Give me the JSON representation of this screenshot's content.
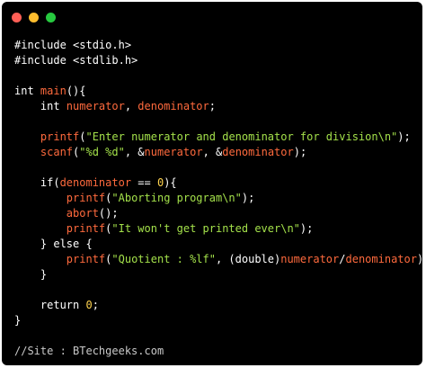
{
  "window": {
    "buttons": [
      {
        "name": "close-button",
        "color": "#ff5f56"
      },
      {
        "name": "minimize-button",
        "color": "#ffbd2e"
      },
      {
        "name": "maximize-button",
        "color": "#27c93f"
      }
    ]
  },
  "code": {
    "lines": [
      [
        {
          "t": "#include <stdio.h>",
          "c": "directive"
        }
      ],
      [
        {
          "t": "#include <stdlib.h>",
          "c": "directive"
        }
      ],
      [],
      [
        {
          "t": "int ",
          "c": "keyword"
        },
        {
          "t": "main",
          "c": "func"
        },
        {
          "t": "(){",
          "c": "plain"
        }
      ],
      [
        {
          "t": "    int ",
          "c": "keyword"
        },
        {
          "t": "numerator",
          "c": "var"
        },
        {
          "t": ", ",
          "c": "plain"
        },
        {
          "t": "denominator",
          "c": "var"
        },
        {
          "t": ";",
          "c": "plain"
        }
      ],
      [],
      [
        {
          "t": "    ",
          "c": "plain"
        },
        {
          "t": "printf",
          "c": "func"
        },
        {
          "t": "(",
          "c": "plain"
        },
        {
          "t": "\"Enter numerator and denominator for division\\n\"",
          "c": "string"
        },
        {
          "t": ");",
          "c": "plain"
        }
      ],
      [
        {
          "t": "    ",
          "c": "plain"
        },
        {
          "t": "scanf",
          "c": "func"
        },
        {
          "t": "(",
          "c": "plain"
        },
        {
          "t": "\"%d %d\"",
          "c": "string"
        },
        {
          "t": ", &",
          "c": "plain"
        },
        {
          "t": "numerator",
          "c": "var"
        },
        {
          "t": ", &",
          "c": "plain"
        },
        {
          "t": "denominator",
          "c": "var"
        },
        {
          "t": ");",
          "c": "plain"
        }
      ],
      [],
      [
        {
          "t": "    if(",
          "c": "keyword"
        },
        {
          "t": "denominator",
          "c": "var"
        },
        {
          "t": " == ",
          "c": "plain"
        },
        {
          "t": "0",
          "c": "number"
        },
        {
          "t": "){",
          "c": "plain"
        }
      ],
      [
        {
          "t": "        ",
          "c": "plain"
        },
        {
          "t": "printf",
          "c": "func"
        },
        {
          "t": "(",
          "c": "plain"
        },
        {
          "t": "\"Aborting program\\n\"",
          "c": "string"
        },
        {
          "t": ");",
          "c": "plain"
        }
      ],
      [
        {
          "t": "        ",
          "c": "plain"
        },
        {
          "t": "abort",
          "c": "func"
        },
        {
          "t": "();",
          "c": "plain"
        }
      ],
      [
        {
          "t": "        ",
          "c": "plain"
        },
        {
          "t": "printf",
          "c": "func"
        },
        {
          "t": "(",
          "c": "plain"
        },
        {
          "t": "\"It won't get printed ever\\n\"",
          "c": "string"
        },
        {
          "t": ");",
          "c": "plain"
        }
      ],
      [
        {
          "t": "    } else {",
          "c": "keyword"
        }
      ],
      [
        {
          "t": "        ",
          "c": "plain"
        },
        {
          "t": "printf",
          "c": "func"
        },
        {
          "t": "(",
          "c": "plain"
        },
        {
          "t": "\"Quotient : %lf\"",
          "c": "string"
        },
        {
          "t": ", (double)",
          "c": "plain"
        },
        {
          "t": "numerator",
          "c": "var"
        },
        {
          "t": "/",
          "c": "plain"
        },
        {
          "t": "denominator",
          "c": "var"
        },
        {
          "t": ");",
          "c": "plain"
        }
      ],
      [
        {
          "t": "    }",
          "c": "plain"
        }
      ],
      [],
      [
        {
          "t": "    return ",
          "c": "keyword"
        },
        {
          "t": "0",
          "c": "number"
        },
        {
          "t": ";",
          "c": "plain"
        }
      ],
      [
        {
          "t": "}",
          "c": "plain"
        }
      ],
      [],
      [
        {
          "t": "//Site : BTechgeeks.com",
          "c": "comment"
        }
      ]
    ]
  }
}
